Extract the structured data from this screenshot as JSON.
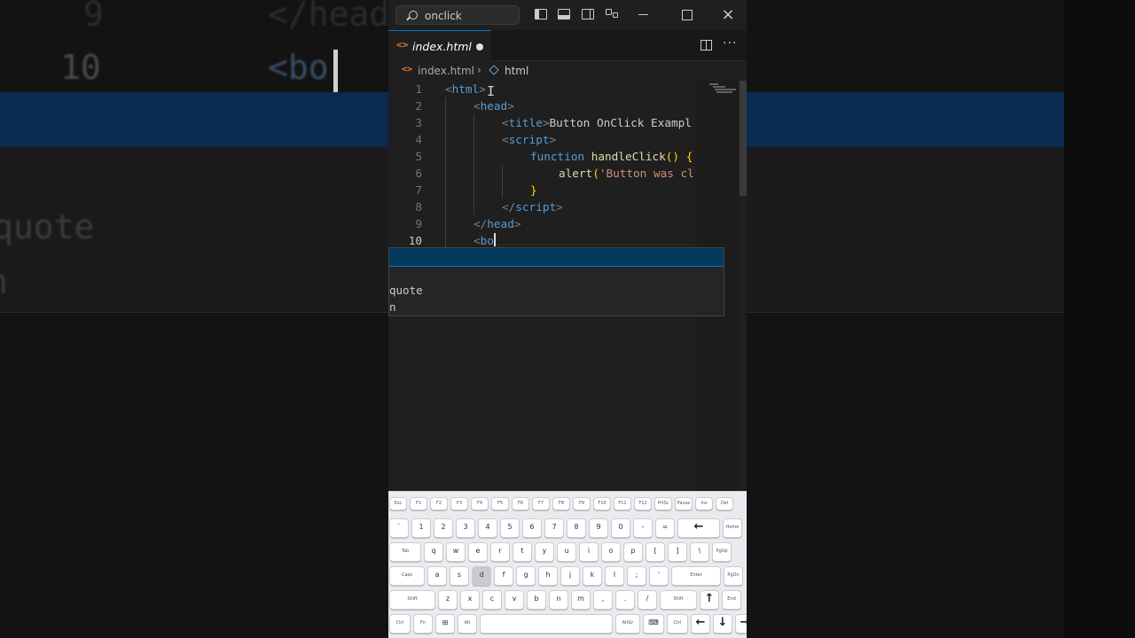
{
  "background": {
    "lines": [
      {
        "num": "9",
        "code": "</head"
      },
      {
        "num": "10",
        "code": "<bo"
      },
      {
        "num": "",
        "code": "quote"
      },
      {
        "num": "",
        "code": "n"
      }
    ]
  },
  "titlebar": {
    "search_text": "onclick",
    "icons": [
      "toggle-primary-sidebar-icon",
      "toggle-panel-icon",
      "toggle-secondary-sidebar-icon",
      "customize-layout-icon"
    ],
    "window_controls": {
      "minimize": "minimize-icon",
      "maximize": "maximize-icon",
      "close": "×"
    }
  },
  "tabs": [
    {
      "label": "index.html",
      "icon": "<>",
      "modified": true
    }
  ],
  "breadcrumb": {
    "file_icon": "<>",
    "file": "index.html",
    "separator": "›",
    "symbol": "html"
  },
  "editor": {
    "lines": [
      {
        "num": "1",
        "segments": [
          {
            "t": "<",
            "c": "br"
          },
          {
            "t": "html",
            "c": "tag"
          },
          {
            "t": ">",
            "c": "br"
          }
        ],
        "indent": 0
      },
      {
        "num": "2",
        "segments": [
          {
            "t": "<",
            "c": "br"
          },
          {
            "t": "head",
            "c": "tag"
          },
          {
            "t": ">",
            "c": "br"
          }
        ],
        "indent": 1
      },
      {
        "num": "3",
        "segments": [
          {
            "t": "<",
            "c": "br"
          },
          {
            "t": "title",
            "c": "tag"
          },
          {
            "t": ">",
            "c": "br"
          },
          {
            "t": "Button OnClick Exampl",
            "c": "txt"
          }
        ],
        "indent": 2
      },
      {
        "num": "4",
        "segments": [
          {
            "t": "<",
            "c": "br"
          },
          {
            "t": "script",
            "c": "tag"
          },
          {
            "t": ">",
            "c": "br"
          }
        ],
        "indent": 2
      },
      {
        "num": "5",
        "segments": [
          {
            "t": "function ",
            "c": "kw"
          },
          {
            "t": "handleClick",
            "c": "fn"
          },
          {
            "t": "() {",
            "c": "pn"
          }
        ],
        "indent": 3
      },
      {
        "num": "6",
        "segments": [
          {
            "t": "alert",
            "c": "fn"
          },
          {
            "t": "(",
            "c": "pn"
          },
          {
            "t": "'Button was cl",
            "c": "str"
          }
        ],
        "indent": 4
      },
      {
        "num": "7",
        "segments": [
          {
            "t": "}",
            "c": "pn"
          }
        ],
        "indent": 3
      },
      {
        "num": "8",
        "segments": [
          {
            "t": "</",
            "c": "br"
          },
          {
            "t": "script",
            "c": "tag"
          },
          {
            "t": ">",
            "c": "br"
          }
        ],
        "indent": 2
      },
      {
        "num": "9",
        "segments": [
          {
            "t": "</",
            "c": "br"
          },
          {
            "t": "head",
            "c": "tag"
          },
          {
            "t": ">",
            "c": "br"
          }
        ],
        "indent": 1
      },
      {
        "num": "10",
        "segments": [
          {
            "t": "<",
            "c": "br"
          },
          {
            "t": "bo",
            "c": "tag"
          }
        ],
        "indent": 1,
        "current": true
      }
    ]
  },
  "suggest": {
    "items": [
      "",
      "",
      "quote",
      "n"
    ]
  },
  "keyboard": {
    "rows": [
      [
        "Esc",
        "F1",
        "F2",
        "F3",
        "F4",
        "F5",
        "F6",
        "F7",
        "F8",
        "F9",
        "F10",
        "F11",
        "F12",
        "PrtSc",
        "Pause",
        "Ins",
        "Del"
      ],
      [
        "`",
        "1",
        "2",
        "3",
        "4",
        "5",
        "6",
        "7",
        "8",
        "9",
        "0",
        "-",
        "=",
        "←",
        "Home"
      ],
      [
        "Tab",
        "q",
        "w",
        "e",
        "r",
        "t",
        "y",
        "u",
        "i",
        "o",
        "p",
        "[",
        "]",
        "\\",
        "PgUp"
      ],
      [
        "Caps",
        "a",
        "s",
        "d",
        "f",
        "g",
        "h",
        "j",
        "k",
        "l",
        ";",
        "'",
        "Enter",
        "PgDn"
      ],
      [
        "Shift",
        "z",
        "x",
        "c",
        "v",
        "b",
        "n",
        "m",
        ",",
        ".",
        "/",
        "Shift",
        "↑",
        "End"
      ],
      [
        "Ctrl",
        "Fn",
        "⊞",
        "Alt",
        "",
        "AltGr",
        "⌨",
        "Ctrl",
        "←",
        "↓",
        "→"
      ]
    ],
    "pressed": "d"
  }
}
